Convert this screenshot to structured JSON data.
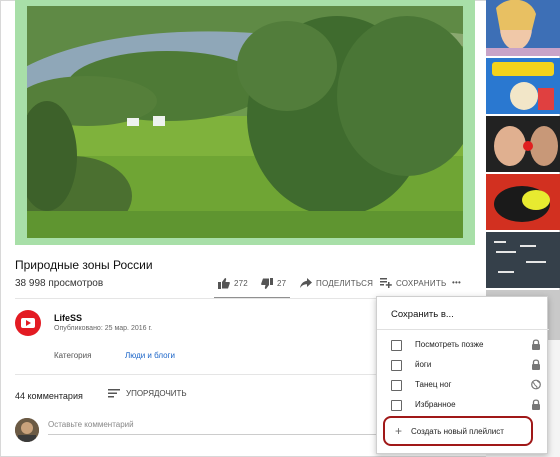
{
  "video": {
    "title": "Природные зоны России",
    "views": "38 998 просмотров"
  },
  "actions": {
    "like_count": "272",
    "dislike_count": "27",
    "share_label": "ПОДЕЛИТЬСЯ",
    "save_label": "СОХРАНИТЬ",
    "more_label": "•••"
  },
  "channel": {
    "name": "LifeSS",
    "published": "Опубликовано: 25 мар. 2016 г.",
    "category_label": "Категория",
    "category_value": "Люди и блоги"
  },
  "comments": {
    "count": "44 комментария",
    "sort_label": "УПОРЯДОЧИТЬ",
    "placeholder": "Оставьте комментарий"
  },
  "save_popup": {
    "title": "Сохранить в...",
    "playlists": [
      {
        "label": "Посмотреть позже",
        "privacy_icon": "lock-icon"
      },
      {
        "label": "йоги",
        "privacy_icon": "lock-icon"
      },
      {
        "label": "Танец ног",
        "privacy_icon": "globe-icon"
      },
      {
        "label": "Избранное",
        "privacy_icon": "lock-icon"
      }
    ],
    "create_label": "Создать новый плейлист"
  },
  "colors": {
    "video_border": "#a8dfa8",
    "channel_avatar": "#e31b23",
    "link_blue": "#1a64c8",
    "highlight_outline": "#a01818"
  }
}
